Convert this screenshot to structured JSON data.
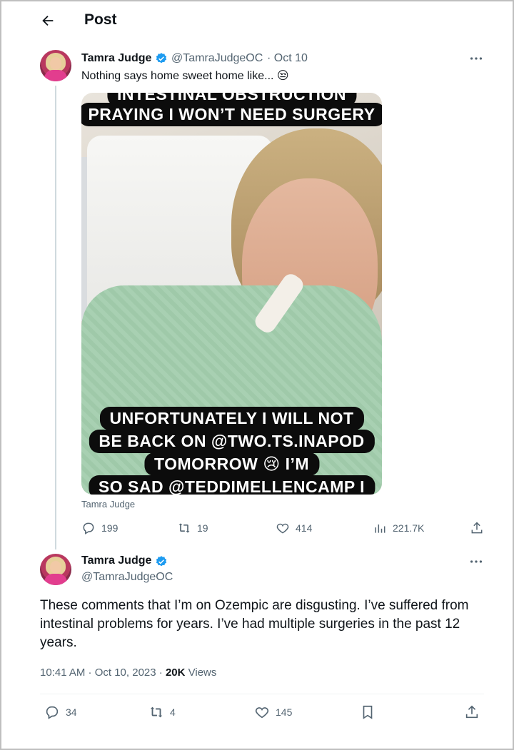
{
  "header": {
    "title": "Post"
  },
  "quoted_tweet": {
    "author_name": "Tamra Judge",
    "handle": "@TamraJudgeOC",
    "date": "· Oct 10",
    "text": "Nothing says home sweet home like... 😒",
    "media_captions": [
      "INTESTINAL OBSTRUCTION",
      "PRAYING I WON’T NEED SURGERY",
      "UNFORTUNATELY I WILL NOT",
      "BE BACK ON @TWO.TS.INAPOD",
      "TOMORROW 😢 I’M",
      "SO SAD @TEDDIMELLENCAMP I"
    ],
    "media_credit": "Tamra Judge",
    "stats": {
      "replies": "199",
      "reposts": "19",
      "likes": "414",
      "views": "221.7K"
    }
  },
  "main_tweet": {
    "author_name": "Tamra Judge",
    "handle": "@TamraJudgeOC",
    "text": "These comments that I’m on Ozempic are disgusting. I’ve suffered from intestinal problems for years. I’ve had multiple surgeries in the past 12 years.",
    "timestamp": "10:41 AM · Oct 10, 2023 · ",
    "views_count": "20K",
    "views_label": " Views",
    "stats": {
      "replies": "34",
      "reposts": "4",
      "likes": "145"
    }
  },
  "colors": {
    "verified": "#1d9bf0",
    "muted": "#536471",
    "text": "#0f1419"
  }
}
